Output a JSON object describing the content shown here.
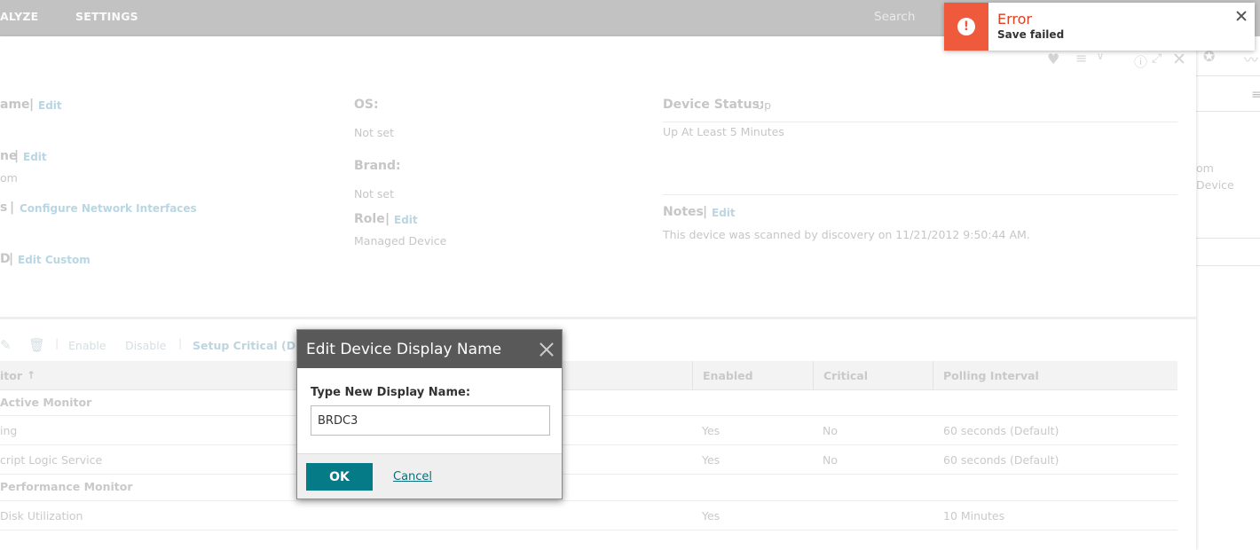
{
  "topnav": {
    "analyze": "ALYZE",
    "settings": "SETTINGS",
    "search_placeholder": "Search"
  },
  "device": {
    "name_label": "ame",
    "name_edit": "Edit",
    "hostname_label": "ne",
    "hostname_edit": "Edit",
    "hostname_value": "om",
    "addresses_label": "s",
    "configure_interfaces": "Configure Network Interfaces",
    "custom_label": "D",
    "edit_custom": "Edit Custom",
    "os_label": "OS:",
    "os_value": "Not set",
    "brand_label": "Brand:",
    "brand_value": "Not set",
    "role_label": "Role",
    "role_edit": "Edit",
    "role_value": "Managed Device",
    "status_label": "Device Status:",
    "status_value": "Up",
    "status_detail": "Up At Least 5 Minutes",
    "notes_label": "Notes",
    "notes_edit": "Edit",
    "notes_value": "This device was scanned by discovery on 11/21/2012 9:50:44 AM."
  },
  "right_panel": {
    "text1": "om",
    "text2": "Device"
  },
  "toolbar": {
    "enable": "Enable",
    "disable": "Disable",
    "setup_critical": "Setup Critical (Disab"
  },
  "table": {
    "headers": {
      "monitor": "itor",
      "enabled": "Enabled",
      "critical": "Critical",
      "polling": "Polling Interval"
    },
    "groups": [
      {
        "name": "Active Monitor"
      },
      {
        "name": "Performance Monitor"
      }
    ],
    "rows": [
      {
        "monitor": "ing",
        "enabled": "Yes",
        "critical": "No",
        "polling": "60 seconds (Default)"
      },
      {
        "monitor": "cript Logic Service",
        "enabled": "Yes",
        "critical": "No",
        "polling": "60 seconds (Default)"
      },
      {
        "monitor": "Disk Utilization",
        "enabled": "Yes",
        "critical": "",
        "polling": "10 Minutes"
      }
    ]
  },
  "modal": {
    "title": "Edit Device Display Name",
    "label": "Type New Display Name:",
    "value": "BRDC3",
    "ok": "OK",
    "cancel": "Cancel"
  },
  "toast": {
    "title": "Error",
    "message": "Save failed",
    "icon": "exclamation-icon"
  },
  "colors": {
    "accent": "#057b87",
    "error": "#f05a3c",
    "modal_header": "#595959"
  }
}
